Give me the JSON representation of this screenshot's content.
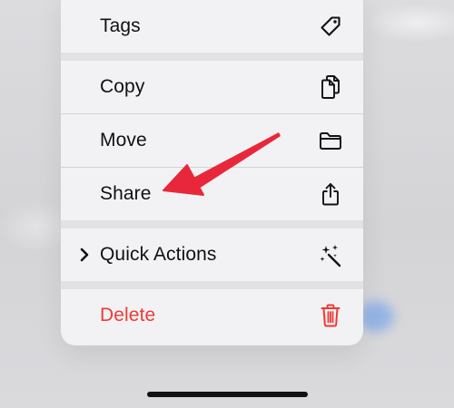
{
  "menu": {
    "items": [
      {
        "label": "Tags",
        "icon": "tag-icon"
      },
      {
        "label": "Copy",
        "icon": "copy-icon"
      },
      {
        "label": "Move",
        "icon": "folder-icon"
      },
      {
        "label": "Share",
        "icon": "share-icon"
      },
      {
        "label": "Quick Actions",
        "icon": "sparkle-wand-icon",
        "submenu_indicator": "chevron-right-icon"
      },
      {
        "label": "Delete",
        "icon": "trash-icon",
        "destructive": true
      }
    ]
  },
  "colors": {
    "menu_background": "#f2f2f5",
    "destructive": "#ee3b32",
    "annotation_arrow": "#e8283a",
    "text": "#111111"
  },
  "annotation": {
    "type": "arrow",
    "points_to": "Share"
  }
}
